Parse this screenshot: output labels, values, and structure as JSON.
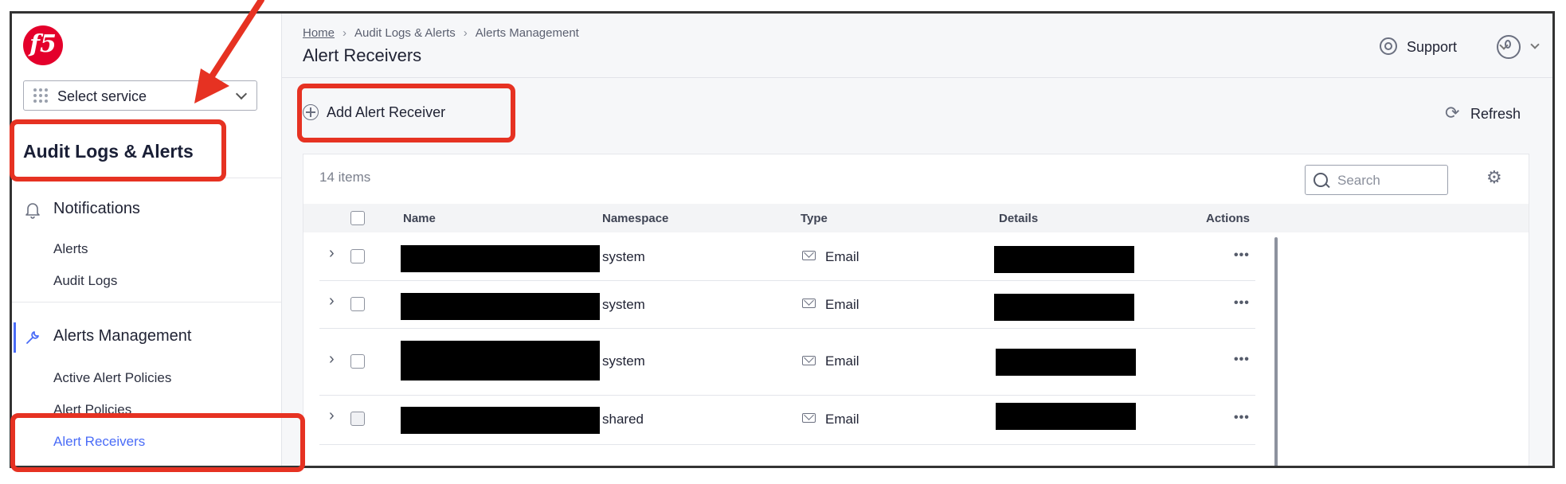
{
  "sidebar": {
    "logo_text": "f5",
    "select_service": "Select service",
    "section_title": "Audit Logs & Alerts",
    "groups": [
      {
        "title": "Notifications",
        "icon": "bell-icon",
        "items": [
          "Alerts",
          "Audit Logs"
        ]
      },
      {
        "title": "Alerts Management",
        "icon": "wrench-icon",
        "items": [
          "Active Alert Policies",
          "Alert Policies",
          "Alert Receivers"
        ]
      }
    ],
    "active_item": "Alert Receivers"
  },
  "header": {
    "breadcrumb": [
      "Home",
      "Audit Logs & Alerts",
      "Alerts Management"
    ],
    "title": "Alert Receivers",
    "support_label": "Support"
  },
  "toolbar": {
    "add_label": "Add Alert Receiver",
    "refresh_label": "Refresh"
  },
  "table": {
    "items_count": "14 items",
    "search_placeholder": "Search",
    "columns": [
      "Name",
      "Namespace",
      "Type",
      "Details",
      "Actions"
    ],
    "rows": [
      {
        "namespace": "system",
        "type": "Email",
        "actions": "•••"
      },
      {
        "namespace": "system",
        "type": "Email",
        "actions": "•••"
      },
      {
        "namespace": "system",
        "type": "Email",
        "actions": "•••"
      },
      {
        "namespace": "shared",
        "type": "Email",
        "actions": "•••"
      }
    ]
  },
  "colors": {
    "annotation_red": "#e63222",
    "active_blue": "#4a6cf7",
    "logo_red": "#e4002b"
  }
}
